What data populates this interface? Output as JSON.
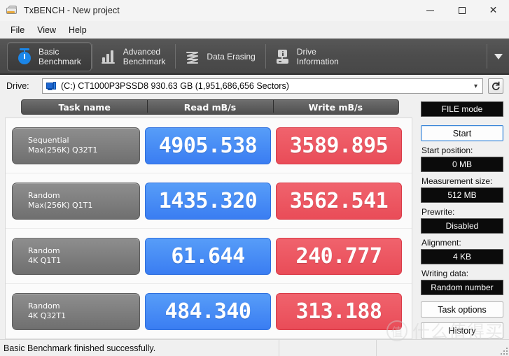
{
  "window": {
    "title": "TxBENCH - New project",
    "app_icon": "drive-app-icon",
    "minimize": "minimize-icon",
    "maximize": "maximize-icon",
    "close": "close-icon"
  },
  "menu": {
    "items": [
      {
        "label": "File"
      },
      {
        "label": "View"
      },
      {
        "label": "Help"
      }
    ]
  },
  "tabs": {
    "items": [
      {
        "label": "Basic\nBenchmark",
        "icon": "stopwatch-icon",
        "active": true
      },
      {
        "label": "Advanced\nBenchmark",
        "icon": "bar-chart-icon",
        "active": false
      },
      {
        "label": "Data Erasing",
        "icon": "shredder-icon",
        "active": false
      },
      {
        "label": "Drive\nInformation",
        "icon": "drive-info-icon",
        "active": false
      }
    ],
    "overflow_icon": "chevron-down-icon"
  },
  "drive": {
    "label": "Drive:",
    "selected": "(C:) CT1000P3PSSD8  930.63 GB (1,951,686,656 Sectors)",
    "icon": "hard-drive-icon",
    "dropdown_icon": "chevron-down-icon",
    "refresh_icon": "refresh-icon"
  },
  "results": {
    "columns": [
      "Task name",
      "Read mB/s",
      "Write mB/s"
    ],
    "rows": [
      {
        "task_line1": "Sequential",
        "task_line2": "Max(256K) Q32T1",
        "read": "4905.538",
        "write": "3589.895"
      },
      {
        "task_line1": "Random",
        "task_line2": "Max(256K) Q1T1",
        "read": "1435.320",
        "write": "3562.541"
      },
      {
        "task_line1": "Random",
        "task_line2": "4K Q1T1",
        "read": "61.644",
        "write": "240.777"
      },
      {
        "task_line1": "Random",
        "task_line2": "4K Q32T1",
        "read": "484.340",
        "write": "313.188"
      }
    ]
  },
  "sidebar": {
    "mode_button": "FILE mode",
    "start_button": "Start",
    "fields": [
      {
        "label": "Start position:",
        "value": "0 MB"
      },
      {
        "label": "Measurement size:",
        "value": "512 MB"
      },
      {
        "label": "Prewrite:",
        "value": "Disabled"
      },
      {
        "label": "Alignment:",
        "value": "4 KB"
      },
      {
        "label": "Writing data:",
        "value": "Random number"
      }
    ],
    "task_options_button": "Task options",
    "history_button": "History"
  },
  "status": {
    "message": "Basic Benchmark finished successfully."
  },
  "watermark": {
    "logo": "值",
    "text": "什么值得买"
  },
  "colors": {
    "read_blue": "#3a7df2",
    "write_red": "#e94c58",
    "tab_strip": "#4d4d4d",
    "accent_focus": "#3a86d8"
  }
}
